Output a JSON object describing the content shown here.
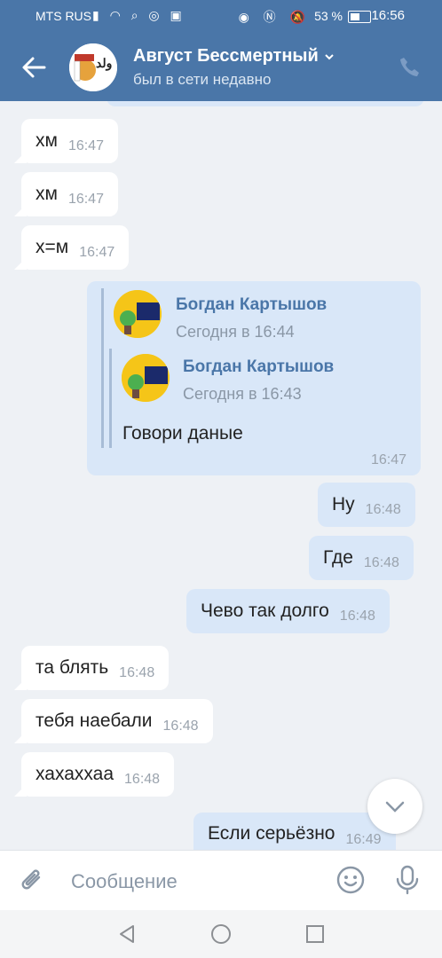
{
  "status_bar": {
    "carrier": "MTS RUS",
    "battery": "53 %",
    "time": "16:56"
  },
  "header": {
    "name": "Август Бессмертный",
    "status": "был в сети недавно",
    "avatar_text": "ولد"
  },
  "messages": [
    {
      "dir": "in",
      "text": "хм",
      "time": "16:47"
    },
    {
      "dir": "in",
      "text": "хм",
      "time": "16:47"
    },
    {
      "dir": "in",
      "text": "х=м",
      "time": "16:47"
    },
    {
      "dir": "out",
      "text": "Ну",
      "time": "16:48"
    },
    {
      "dir": "out",
      "text": "Где",
      "time": "16:48"
    },
    {
      "dir": "out",
      "text": "Чево так долго",
      "time": "16:48"
    },
    {
      "dir": "in",
      "text": "та блять",
      "time": "16:48"
    },
    {
      "dir": "in",
      "text": "тебя наебали",
      "time": "16:48"
    },
    {
      "dir": "in",
      "text": "хахаххаа",
      "time": "16:48"
    },
    {
      "dir": "out",
      "text": "Если серьёзно",
      "time": "16:49"
    }
  ],
  "forwarded": {
    "outer_name": "Богдан Картышов",
    "outer_date": "Сегодня в 16:44",
    "inner_name": "Богдан Картышов",
    "inner_date": "Сегодня в 16:43",
    "text": "Говори даные",
    "time": "16:47"
  },
  "composer": {
    "placeholder": "Сообщение"
  },
  "colors": {
    "header": "#4a76a8",
    "outgoing": "#d9e7f8",
    "incoming": "#ffffff",
    "background": "#eef1f5"
  }
}
